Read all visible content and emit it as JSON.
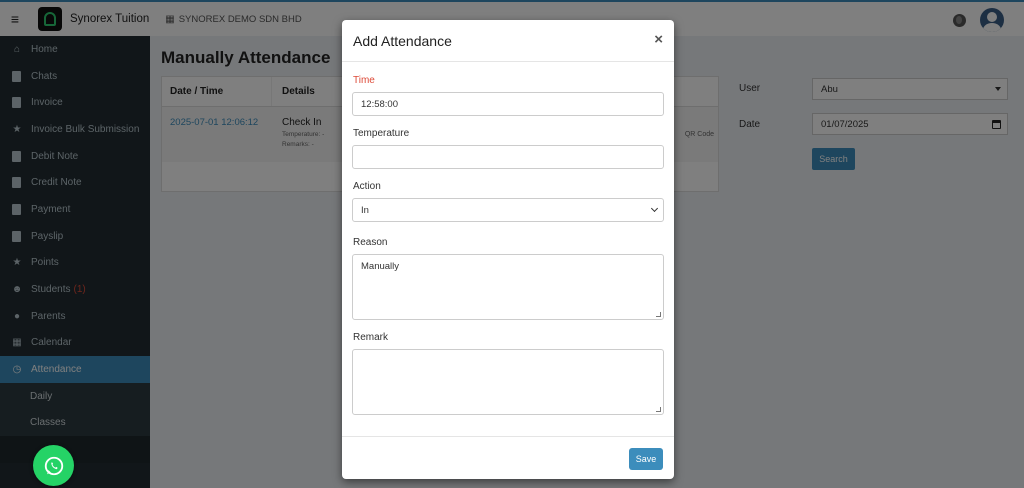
{
  "topbar": {
    "brand": "Synorex Tuition",
    "company": "SYNOREX DEMO SDN BHD"
  },
  "sidebar": {
    "items": [
      {
        "label": "Home",
        "icon": "home-icon"
      },
      {
        "label": "Chats",
        "icon": "document-icon"
      },
      {
        "label": "Invoice",
        "icon": "document-icon"
      },
      {
        "label": "Invoice Bulk Submission",
        "icon": "star-icon"
      },
      {
        "label": "Debit Note",
        "icon": "document-icon"
      },
      {
        "label": "Credit Note",
        "icon": "document-icon"
      },
      {
        "label": "Payment",
        "icon": "document-icon"
      },
      {
        "label": "Payslip",
        "icon": "document-icon"
      },
      {
        "label": "Points",
        "icon": "star-icon"
      },
      {
        "label": "Students",
        "badge": "(1)",
        "icon": "users-icon"
      },
      {
        "label": "Parents",
        "icon": "user-circle-icon"
      },
      {
        "label": "Calendar",
        "icon": "calendar-icon"
      },
      {
        "label": "Attendance",
        "icon": "clock-icon",
        "active": true
      }
    ],
    "sub_items": [
      "Daily",
      "Classes"
    ]
  },
  "main": {
    "title": "Manually Attendance",
    "table": {
      "headers": [
        "Date / Time",
        "Details"
      ],
      "rows": [
        {
          "datetime": "2025-07-01 12:06:12",
          "action": "Check In",
          "temperature": "Temperature: -",
          "remarks": "Remarks: -",
          "method": "QR Code"
        }
      ]
    },
    "filters": {
      "user_label": "User",
      "user_value": "Abu",
      "date_label": "Date",
      "date_value": "01/07/2025",
      "search_label": "Search"
    }
  },
  "modal": {
    "title": "Add Attendance",
    "close": "×",
    "time_label": "Time",
    "time_value": "12:58:00",
    "temperature_label": "Temperature",
    "temperature_value": "",
    "action_label": "Action",
    "action_value": "In",
    "reason_label": "Reason",
    "reason_value": "Manually",
    "remark_label": "Remark",
    "remark_value": "",
    "save_label": "Save"
  },
  "colors": {
    "primary": "#3c8dbc",
    "sidebar": "#222d32",
    "required": "#dd4b39",
    "whatsapp": "#25d366"
  }
}
